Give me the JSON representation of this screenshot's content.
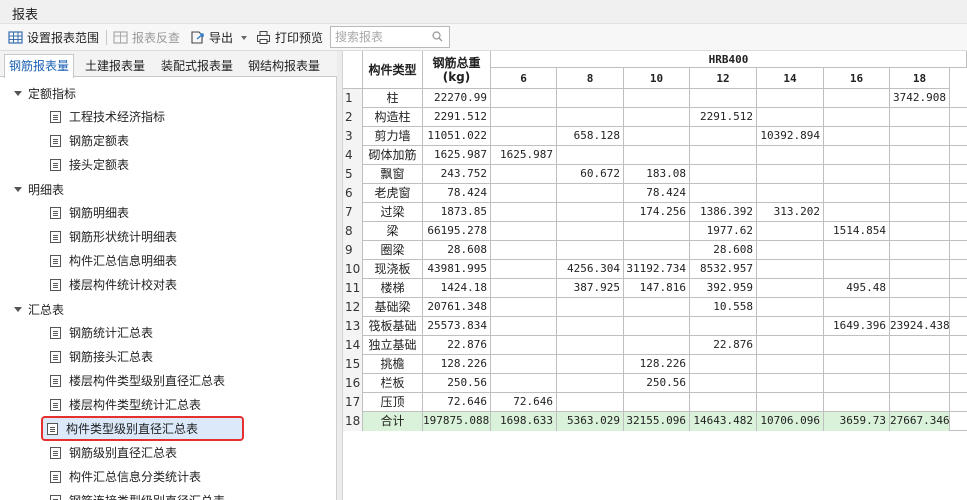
{
  "window": {
    "title": "报表"
  },
  "toolbar": {
    "set_range": "设置报表范围",
    "reverse_check": "报表反查",
    "export": "导出",
    "print_preview": "打印预览",
    "search_placeholder": "搜索报表"
  },
  "tabs": [
    "钢筋报表量",
    "土建报表量",
    "装配式报表量",
    "钢结构报表量"
  ],
  "tree": {
    "groups": [
      {
        "label": "定额指标",
        "items": [
          "工程技术经济指标",
          "钢筋定额表",
          "接头定额表"
        ]
      },
      {
        "label": "明细表",
        "items": [
          "钢筋明细表",
          "钢筋形状统计明细表",
          "构件汇总信息明细表",
          "楼层构件统计校对表"
        ]
      },
      {
        "label": "汇总表",
        "items": [
          "钢筋统计汇总表",
          "钢筋接头汇总表",
          "楼层构件类型级别直径汇总表",
          "楼层构件类型统计汇总表",
          "构件类型级别直径汇总表",
          "钢筋级别直径汇总表",
          "构件汇总信息分类统计表",
          "钢筋连接类型级别直径汇总表"
        ]
      }
    ],
    "selected": "构件类型级别直径汇总表"
  },
  "table": {
    "col_type": "构件类型",
    "col_total_line1": "钢筋总重",
    "col_total_line2": "(kg)",
    "grade": "HRB400",
    "diameters": [
      "6",
      "8",
      "10",
      "12",
      "14",
      "16",
      "18"
    ],
    "rows": [
      {
        "no": "1",
        "name": "柱",
        "total": "22270.99",
        "vals": [
          "",
          "",
          "",
          "",
          "",
          "",
          "3742.908"
        ]
      },
      {
        "no": "2",
        "name": "构造柱",
        "total": "2291.512",
        "vals": [
          "",
          "",
          "",
          "2291.512",
          "",
          "",
          ""
        ]
      },
      {
        "no": "3",
        "name": "剪力墙",
        "total": "11051.022",
        "vals": [
          "",
          "658.128",
          "",
          "",
          "10392.894",
          "",
          ""
        ]
      },
      {
        "no": "4",
        "name": "砌体加筋",
        "total": "1625.987",
        "vals": [
          "1625.987",
          "",
          "",
          "",
          "",
          "",
          ""
        ]
      },
      {
        "no": "5",
        "name": "飘窗",
        "total": "243.752",
        "vals": [
          "",
          "60.672",
          "183.08",
          "",
          "",
          "",
          ""
        ]
      },
      {
        "no": "6",
        "name": "老虎窗",
        "total": "78.424",
        "vals": [
          "",
          "",
          "78.424",
          "",
          "",
          "",
          ""
        ]
      },
      {
        "no": "7",
        "name": "过梁",
        "total": "1873.85",
        "vals": [
          "",
          "",
          "174.256",
          "1386.392",
          "313.202",
          "",
          ""
        ]
      },
      {
        "no": "8",
        "name": "梁",
        "total": "66195.278",
        "vals": [
          "",
          "",
          "",
          "1977.62",
          "",
          "1514.854",
          ""
        ]
      },
      {
        "no": "9",
        "name": "圈梁",
        "total": "28.608",
        "vals": [
          "",
          "",
          "",
          "28.608",
          "",
          "",
          ""
        ]
      },
      {
        "no": "10",
        "name": "现浇板",
        "total": "43981.995",
        "vals": [
          "",
          "4256.304",
          "31192.734",
          "8532.957",
          "",
          "",
          ""
        ]
      },
      {
        "no": "11",
        "name": "楼梯",
        "total": "1424.18",
        "vals": [
          "",
          "387.925",
          "147.816",
          "392.959",
          "",
          "495.48",
          ""
        ]
      },
      {
        "no": "12",
        "name": "基础梁",
        "total": "20761.348",
        "vals": [
          "",
          "",
          "",
          "10.558",
          "",
          "",
          ""
        ]
      },
      {
        "no": "13",
        "name": "筏板基础",
        "total": "25573.834",
        "vals": [
          "",
          "",
          "",
          "",
          "",
          "1649.396",
          "23924.438"
        ]
      },
      {
        "no": "14",
        "name": "独立基础",
        "total": "22.876",
        "vals": [
          "",
          "",
          "",
          "22.876",
          "",
          "",
          ""
        ]
      },
      {
        "no": "15",
        "name": "挑檐",
        "total": "128.226",
        "vals": [
          "",
          "",
          "128.226",
          "",
          "",
          "",
          ""
        ]
      },
      {
        "no": "16",
        "name": "栏板",
        "total": "250.56",
        "vals": [
          "",
          "",
          "250.56",
          "",
          "",
          "",
          ""
        ]
      },
      {
        "no": "17",
        "name": "压顶",
        "total": "72.646",
        "vals": [
          "72.646",
          "",
          "",
          "",
          "",
          "",
          ""
        ]
      },
      {
        "no": "18",
        "name": "合计",
        "total": "197875.088",
        "vals": [
          "1698.633",
          "5363.029",
          "32155.096",
          "14643.482",
          "10706.096",
          "3659.73",
          "27667.346"
        ]
      }
    ]
  },
  "colors": {
    "selected_outline": "#e63030",
    "total_row_bg": "#d9f2d9",
    "active_tab_text": "#1a5fb4"
  }
}
